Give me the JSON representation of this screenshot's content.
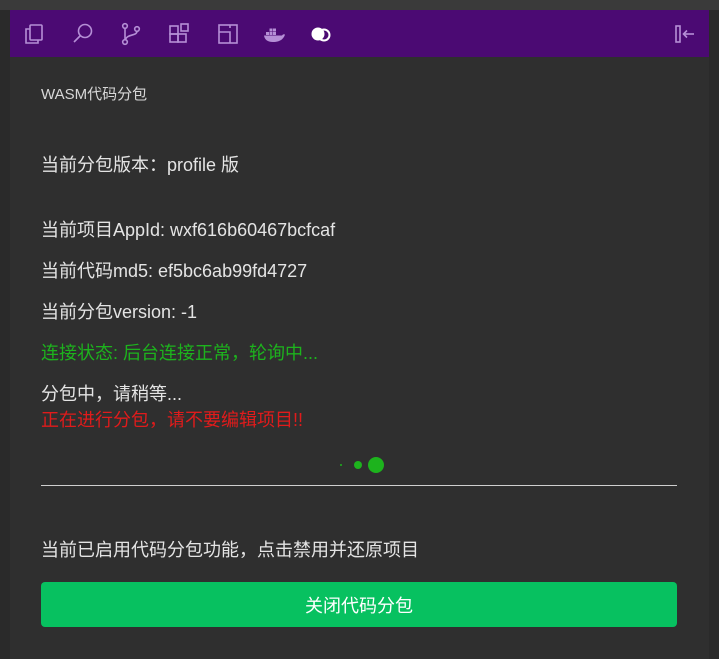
{
  "toolbar": {
    "icons": [
      "copy-icon",
      "search-icon",
      "source-control-icon",
      "extensions-icon",
      "layout-icon",
      "docker-icon",
      "wasm-icon"
    ],
    "collapse_icon": "collapse-panel-icon",
    "icon_color": "#b58fd6",
    "background": "#4b0a73"
  },
  "panel": {
    "title": "WASM代码分包",
    "version_line": "当前分包版本：profile 版",
    "appid_line": "当前项目AppId: wxf616b60467bcfcaf",
    "md5_line": "当前代码md5: ef5bc6ab99fd4727",
    "pkg_version_line": "当前分包version: -1",
    "status_line": "连接状态: 后台连接正常，轮询中...",
    "progress_line": "分包中，请稍等...",
    "warning_line": "正在进行分包，请不要编辑项目!!",
    "footer_text": "当前已启用代码分包功能，点击禁用并还原项目",
    "button_label": "关闭代码分包"
  },
  "colors": {
    "status": "#1db31d",
    "warning": "#e01b1b",
    "button": "#07c160"
  }
}
